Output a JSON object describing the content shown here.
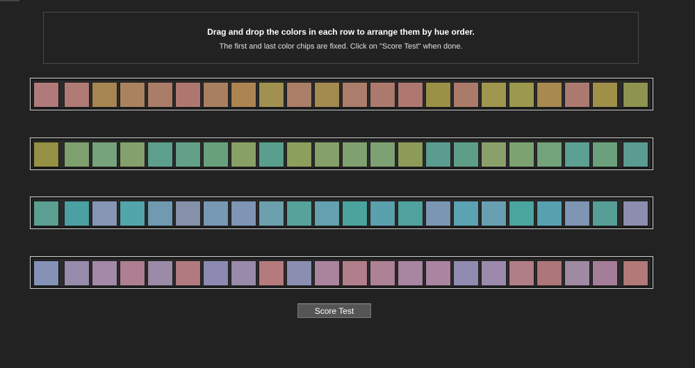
{
  "instructions": {
    "title": "Drag and drop the colors in each row to arrange them by hue order.",
    "subtitle": "The first and last color chips are fixed. Click on \"Score Test\" when done."
  },
  "rows": [
    {
      "fixed_first": "#b07a7a",
      "movable": [
        "#b07a74",
        "#a78552",
        "#aa8260",
        "#aa7d68",
        "#ad776f",
        "#a88060",
        "#ac8451",
        "#a09150",
        "#aa7e67",
        "#a38a4f",
        "#ab7d6a",
        "#ac7a6c",
        "#ae7870",
        "#9a9147",
        "#aa7a6a",
        "#a0964e",
        "#9a994d",
        "#a8894f",
        "#ac7970",
        "#a08f49"
      ],
      "fixed_last": "#8e9450"
    },
    {
      "fixed_first": "#949044",
      "movable": [
        "#7ea06f",
        "#76a27c",
        "#84a06d",
        "#5c9f8c",
        "#62a087",
        "#66a17b",
        "#88a066",
        "#5a9f8e",
        "#8d9f5d",
        "#85a068",
        "#7fa06f",
        "#7da173",
        "#8c9b58",
        "#5a9d90",
        "#5e9e88",
        "#8aa06b",
        "#7da271",
        "#72a37b",
        "#5ba093",
        "#6aa17c"
      ],
      "fixed_last": "#5a9c92"
    },
    {
      "fixed_first": "#5a9f92",
      "movable": [
        "#4aa0a2",
        "#8596b4",
        "#52a5aa",
        "#6f9ab0",
        "#8590aa",
        "#7799b4",
        "#7e95b3",
        "#6ca0ad",
        "#55a39a",
        "#63a1b0",
        "#4aa39c",
        "#5ba0ad",
        "#4fa29d",
        "#7a96b2",
        "#5ba2b2",
        "#68a0b1",
        "#4ba59f",
        "#57a1b1",
        "#7e95b4",
        "#559f97"
      ],
      "fixed_last": "#8d8eaf"
    },
    {
      "fixed_first": "#8592b6",
      "movable": [
        "#978cac",
        "#a289a6",
        "#ad7f91",
        "#9b8aa8",
        "#b07a80",
        "#8c8ab0",
        "#998aaa",
        "#b57a7e",
        "#8a8fb1",
        "#aa849d",
        "#b07f8b",
        "#ae8194",
        "#a885a1",
        "#aa85a0",
        "#8f8ab0",
        "#9c8aac",
        "#b07e87",
        "#ad7779",
        "#a08aa3",
        "#a47e99"
      ],
      "fixed_last": "#b17977"
    }
  ],
  "button": {
    "label": "Score Test"
  }
}
